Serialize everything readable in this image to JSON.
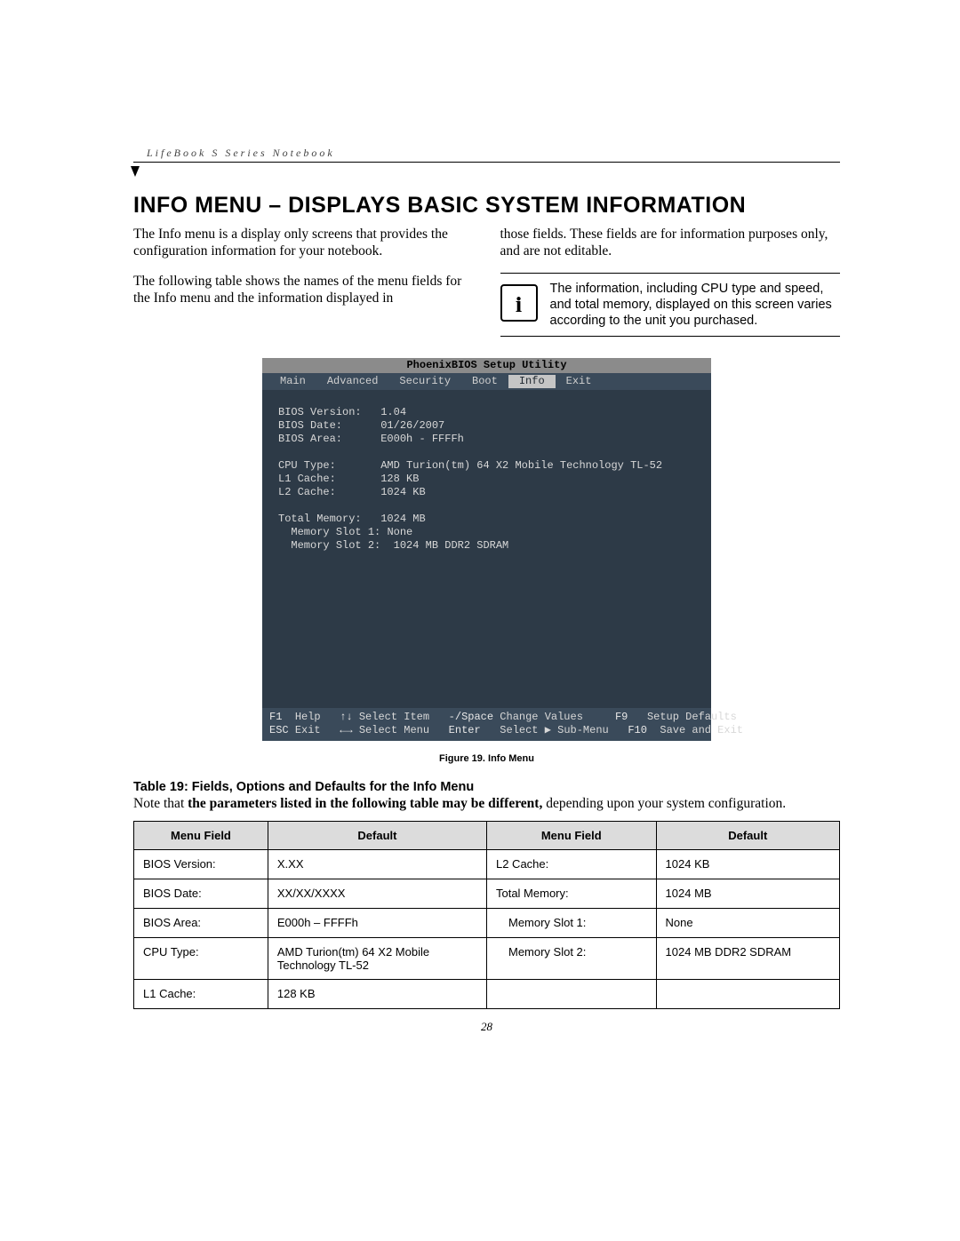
{
  "header": "LifeBook S Series Notebook",
  "title": "INFO MENU – DISPLAYS BASIC SYSTEM INFORMATION",
  "para1": "The Info menu is a display only screens that provides the configuration information for your notebook.",
  "para2": "The following table shows the names of the menu fields for the Info menu and the information displayed in",
  "para3": "those fields. These fields are for information purposes only, and are not editable.",
  "note": "The information, including CPU type and speed, and total memory, displayed on this screen varies according to the unit you purchased.",
  "bios": {
    "title": "PhoenixBIOS Setup Utility",
    "tabs": [
      "Main",
      "Advanced",
      "Security",
      "Boot",
      "Info",
      "Exit"
    ],
    "active_tab": "Info",
    "fields": {
      "bios_version_label": "BIOS Version:",
      "bios_version": "1.04",
      "bios_date_label": "BIOS Date:",
      "bios_date": "01/26/2007",
      "bios_area_label": "BIOS Area:",
      "bios_area": "E000h - FFFFh",
      "cpu_type_label": "CPU Type:",
      "cpu_type": "AMD Turion(tm) 64 X2 Mobile Technology TL-52",
      "l1_label": "L1 Cache:",
      "l1": "128 KB",
      "l2_label": "L2 Cache:",
      "l2": "1024 KB",
      "total_mem_label": "Total Memory:",
      "total_mem": "1024 MB",
      "slot1_label": "Memory Slot 1:",
      "slot1": "None",
      "slot2_label": "Memory Slot 2:",
      "slot2": "1024 MB DDR2 SDRAM"
    },
    "footer": {
      "f1": "F1",
      "help": "Help",
      "select_item": "Select Item",
      "change_values": "Change Values",
      "f9": "F9",
      "setup_defaults": "Setup Defaults",
      "esc": "ESC",
      "exit": "Exit",
      "select_menu": "Select Menu",
      "enter": "Enter",
      "select_sub": "Select ▶ Sub-Menu",
      "f10": "F10",
      "save_exit": "Save and Exit",
      "minus_space": "-/Space",
      "updown": "↑↓",
      "leftright": "←→"
    }
  },
  "figure_caption": "Figure 19.   Info Menu",
  "table_caption": "Table 19: Fields, Options and Defaults for the Info Menu",
  "table_note_prefix": "Note that ",
  "table_note_bold": "the parameters listed in the following table may be different,",
  "table_note_suffix": " depending upon your system configuration.",
  "table": {
    "h1": "Menu Field",
    "h2": "Default",
    "h3": "Menu Field",
    "h4": "Default",
    "rows": [
      {
        "f1": "BIOS Version:",
        "d1": "X.XX",
        "f2": "L2 Cache:",
        "d2": "1024 KB"
      },
      {
        "f1": "BIOS Date:",
        "d1": "XX/XX/XXXX",
        "f2": "Total Memory:",
        "d2": "1024 MB"
      },
      {
        "f1": "BIOS Area:",
        "d1": "E000h – FFFFh",
        "f2": "Memory Slot 1:",
        "d2": "None",
        "indent2": true
      },
      {
        "f1": "CPU Type:",
        "d1": "AMD Turion(tm) 64 X2 Mobile Technology TL-52",
        "f2": "Memory Slot 2:",
        "d2": "1024 MB DDR2 SDRAM",
        "indent2": true
      },
      {
        "f1": "L1 Cache:",
        "d1": "128 KB",
        "f2": "",
        "d2": ""
      }
    ]
  },
  "page_number": "28"
}
